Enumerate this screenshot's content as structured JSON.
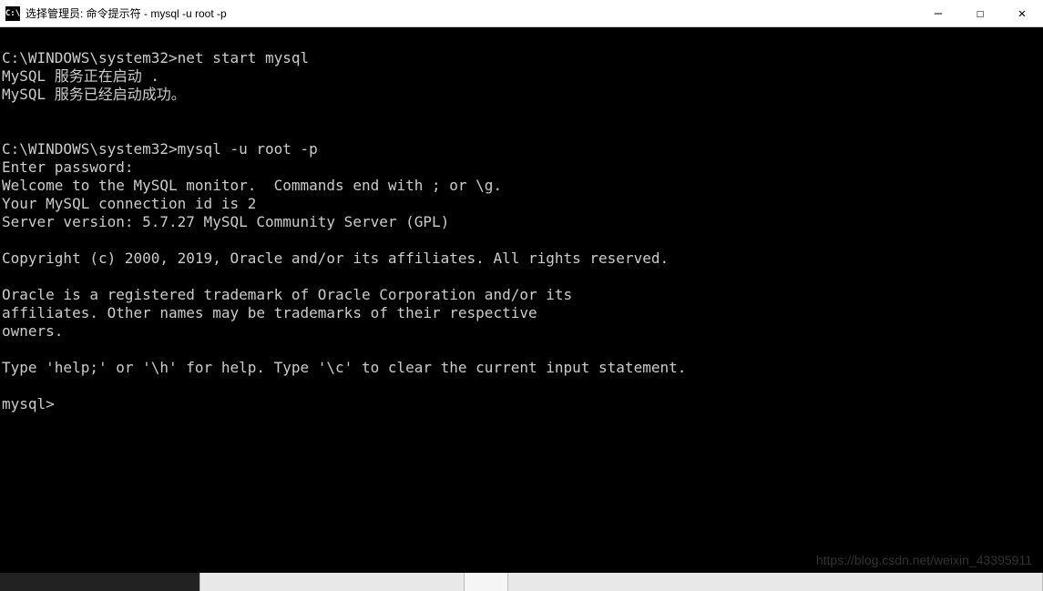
{
  "titlebar": {
    "icon_label": "C:\\",
    "title": "选择管理员: 命令提示符 - mysql  -u root -p"
  },
  "window_controls": {
    "minimize": "—",
    "maximize": "☐",
    "close": "✕"
  },
  "terminal": {
    "lines": [
      "",
      "C:\\WINDOWS\\system32>net start mysql",
      "MySQL 服务正在启动 .",
      "MySQL 服务已经启动成功。",
      "",
      "",
      "C:\\WINDOWS\\system32>mysql -u root -p",
      "Enter password:",
      "Welcome to the MySQL monitor.  Commands end with ; or \\g.",
      "Your MySQL connection id is 2",
      "Server version: 5.7.27 MySQL Community Server (GPL)",
      "",
      "Copyright (c) 2000, 2019, Oracle and/or its affiliates. All rights reserved.",
      "",
      "Oracle is a registered trademark of Oracle Corporation and/or its",
      "affiliates. Other names may be trademarks of their respective",
      "owners.",
      "",
      "Type 'help;' or '\\h' for help. Type '\\c' to clear the current input statement.",
      "",
      "mysql>"
    ]
  },
  "watermark": "https://blog.csdn.net/weixin_43395911",
  "bottom_bar": {
    "time_fragment": ""
  }
}
